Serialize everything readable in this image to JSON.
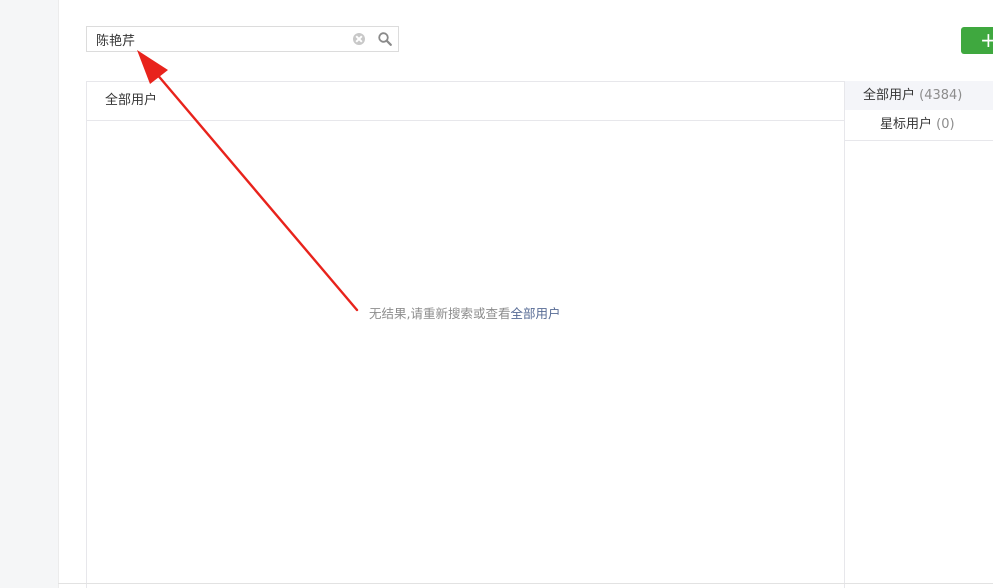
{
  "search": {
    "value": "陈艳芹",
    "placeholder": ""
  },
  "toolbar": {
    "add_label": "+"
  },
  "main": {
    "header_title": "全部用户",
    "empty_text": "无结果,请重新搜索或查看",
    "empty_link": "全部用户"
  },
  "groups": [
    {
      "label": "全部用户",
      "count": "(4384)"
    },
    {
      "label": "星标用户",
      "count": "(0)"
    }
  ],
  "colors": {
    "accent_green": "#3fa83f",
    "link_blue": "#576b95",
    "annotation_red": "#e8231c"
  },
  "icons": {
    "clear": "clear-icon",
    "search": "search-icon"
  }
}
